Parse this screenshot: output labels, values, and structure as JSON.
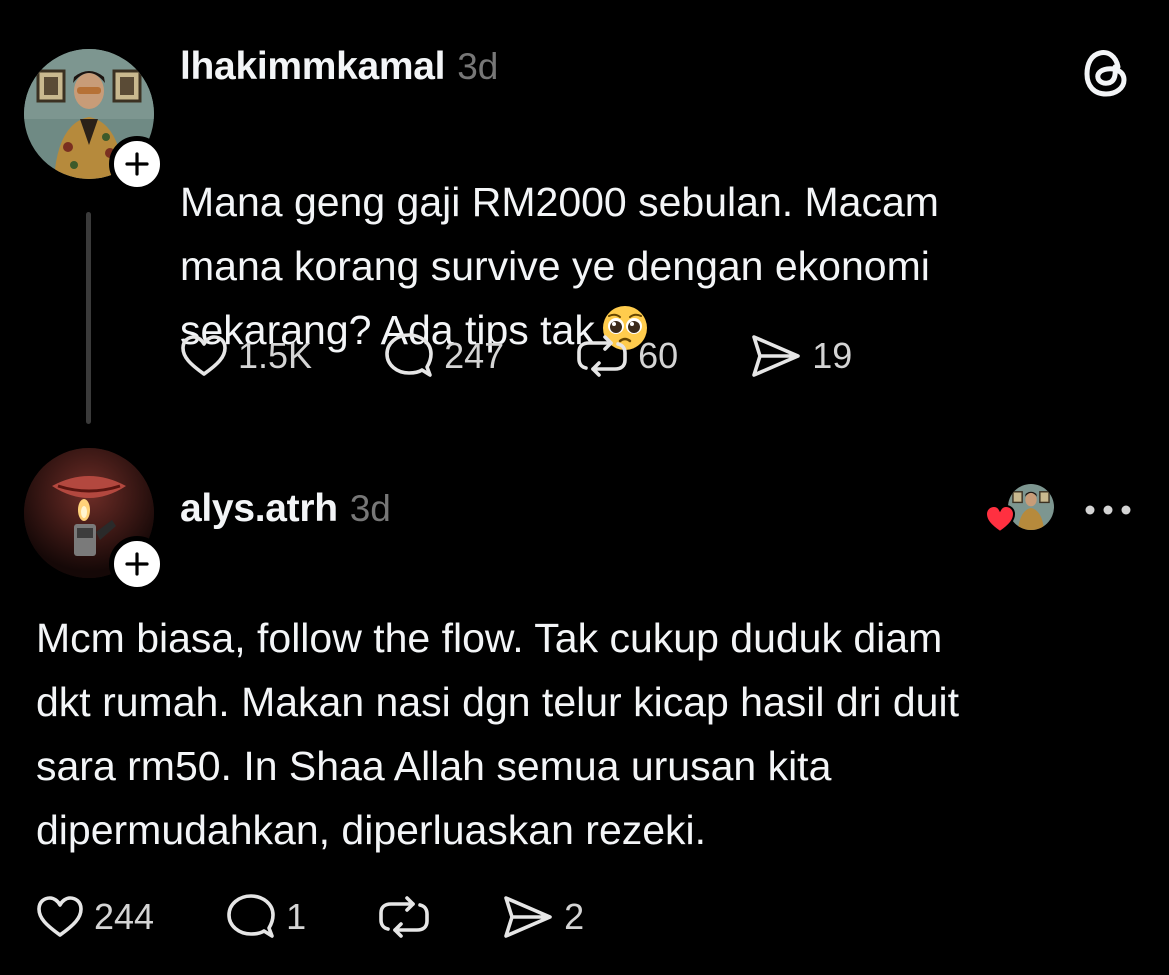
{
  "app": {
    "logo_icon": "threads-logo-icon"
  },
  "post": {
    "username": "lhakimmkamal",
    "time": "3d",
    "text": "Mana geng gaji RM2000 sebulan. Macam\nmana korang survive ye dengan ekonomi\nsekarang? Ada tips tak",
    "emoji": "pleading-face",
    "stats": {
      "likes": "1.5K",
      "replies": "247",
      "reposts": "60",
      "shares": "19"
    }
  },
  "reply": {
    "username": "alys.atrh",
    "time": "3d",
    "liked_by_author": true,
    "text": "Mcm biasa, follow the flow. Tak cukup duduk diam\ndkt rumah. Makan nasi dgn telur kicap hasil dri duit\nsara rm50. In Shaa Allah semua urusan kita\ndipermudahkan, diperluaskan rezeki.",
    "stats": {
      "likes": "244",
      "replies": "1",
      "shares": "2"
    }
  },
  "colors": {
    "background": "#000000",
    "text": "#f3f5f7",
    "muted": "#777777",
    "heart": "#ff3040"
  }
}
